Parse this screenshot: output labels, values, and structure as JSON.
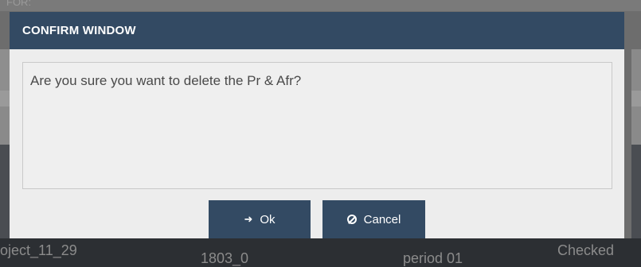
{
  "background": {
    "top_text": "FOR:",
    "row": {
      "col1": "oject_11_29",
      "col2": "1803_0",
      "col3": "period 01",
      "col4": "Checked"
    }
  },
  "modal": {
    "title": "CONFIRM WINDOW",
    "message": "Are you sure you want to delete the Pr & Afr?",
    "ok_label": "Ok",
    "cancel_label": "Cancel"
  },
  "colors": {
    "header": "#334a63",
    "button": "#334a63",
    "body": "#ededed"
  }
}
